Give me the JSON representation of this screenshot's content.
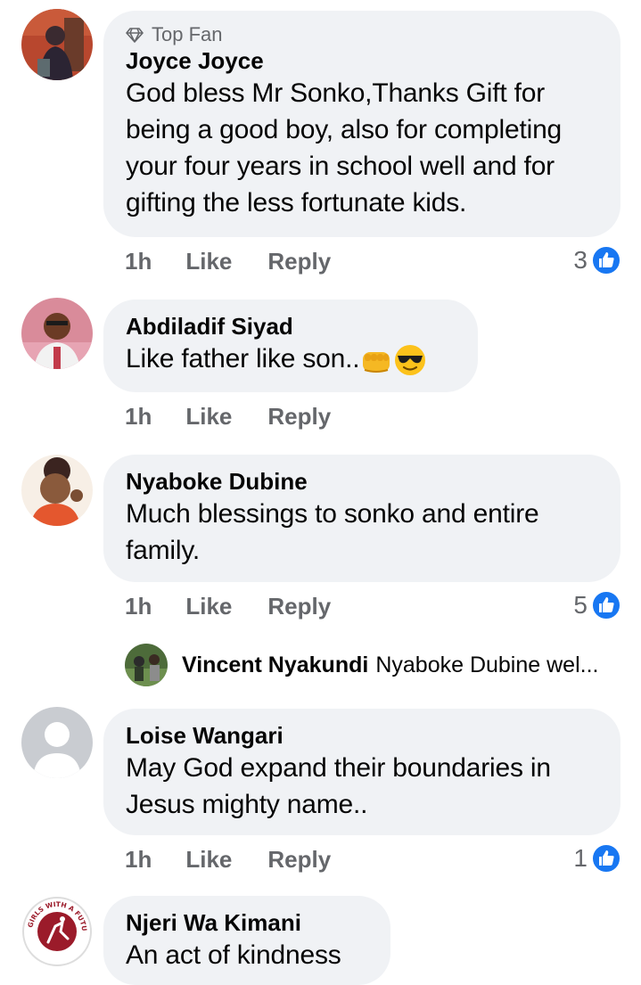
{
  "comments": [
    {
      "badge": "Top Fan",
      "name": "Joyce Joyce",
      "lines": [
        "God bless Mr Sonko,Thanks Gift for",
        "being a good boy, also for completing",
        "your four years in school well and for",
        "gifting the less fortunate kids."
      ],
      "time": "1h",
      "like": "Like",
      "reply": "Reply",
      "reactions": "3"
    },
    {
      "name": "Abdiladif Siyad",
      "text": "Like father like son..",
      "emojis": [
        "fist-emoji",
        "sunglasses-emoji"
      ],
      "time": "1h",
      "like": "Like",
      "reply": "Reply"
    },
    {
      "name": "Nyaboke Dubine",
      "lines": [
        "Much blessings to sonko and entire",
        "family."
      ],
      "time": "1h",
      "like": "Like",
      "reply": "Reply",
      "reactions": "5"
    },
    {
      "name": "Loise Wangari",
      "lines": [
        "May God expand their boundaries in",
        "Jesus mighty name.."
      ],
      "time": "1h",
      "like": "Like",
      "reply": "Reply",
      "reactions": "1"
    },
    {
      "name": "Njeri Wa Kimani",
      "lines": [
        "An act of kindness"
      ]
    }
  ],
  "reply_preview": {
    "name": "Vincent Nyakundi",
    "text": "Nyaboke Dubine wel..."
  },
  "avatar_texts": {
    "njeri_logo": "GIRLS WITH A FUTURE"
  },
  "colors": {
    "bubble": "#f0f2f5",
    "secondary_text": "#65676b",
    "like_blue": "#1877f2"
  }
}
